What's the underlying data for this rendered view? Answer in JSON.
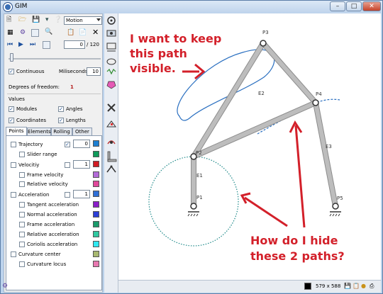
{
  "window": {
    "title": "GIM"
  },
  "toolbar": {
    "mode_select": "Motion",
    "frame_current": "0",
    "frame_total": "/ 120"
  },
  "options": {
    "continuous_label": "Continuous",
    "milliseconds_label": "Miliseconds",
    "milliseconds_value": "10",
    "dof_label": "Degrees of freedom:",
    "dof_value": "1",
    "values_label": "Values",
    "modules_label": "Modules",
    "angles_label": "Angles",
    "coordinates_label": "Coordinates",
    "lengths_label": "Lengths"
  },
  "tabs": [
    "Points",
    "Elements",
    "Rolling",
    "Other"
  ],
  "points_panel": {
    "trajectory_label": "Trajectory",
    "trajectory_value": "0",
    "slider_range_label": "Slider range",
    "velocity_label": "Velocitiy",
    "velocity_value": "1",
    "frame_velocity_label": "Frame velocity",
    "relative_velocity_label": "Relative velocity",
    "acceleration_label": "Acceleration",
    "acceleration_value": "1",
    "tangent_acc_label": "Tangent acceleration",
    "normal_acc_label": "Normal acceleration",
    "frame_acc_label": "Frame acceleration",
    "relative_acc_label": "Relative acceleration",
    "coriolis_acc_label": "Coriolis acceleration",
    "curvature_center_label": "Curvature center",
    "curvature_locus_label": "Curvature locus"
  },
  "swatch_colors": {
    "trajectory": "#1e7fd1",
    "slider_range": "#0f9a5a",
    "velocity": "#d11c24",
    "frame_velocity": "#b36bd8",
    "relative_velocity": "#e0489a",
    "acceleration": "#2f6fd6",
    "tangent": "#8a1ec8",
    "normal": "#2b3fd6",
    "frame": "#1a9a6a",
    "relative": "#30c8a0",
    "coriolis": "#30e8f0",
    "curvature_center": "#a8b870",
    "curvature_locus": "#e878b0"
  },
  "canvas": {
    "labels": {
      "p1": "P1",
      "p2": "P2",
      "p3": "P3",
      "p4": "P4",
      "p5": "P5",
      "e1": "E1",
      "e2": "E2",
      "e3": "E3"
    },
    "annotations": {
      "keep_line1": "I want to keep",
      "keep_line2": "this path",
      "keep_line3": "visible.",
      "hide_line1": "How do I hide",
      "hide_line2": "these 2 paths?"
    },
    "annotation_color": "#d3202a",
    "path_color": "#2a6fc0"
  },
  "status": {
    "size_text": "579 x 588"
  }
}
